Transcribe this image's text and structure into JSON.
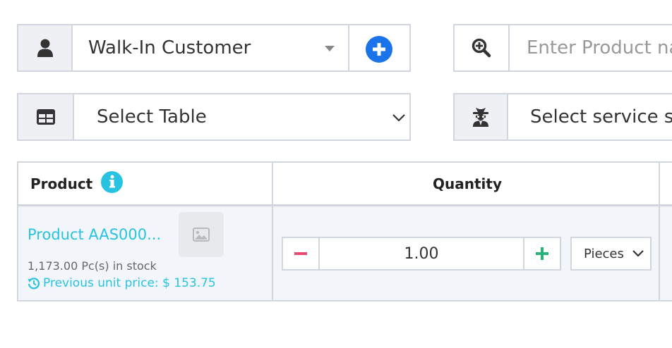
{
  "customer": {
    "icon": "user-icon",
    "value": "Walk-In Customer",
    "add_icon": "plus-circle-icon",
    "accent_color": "#1a73e8"
  },
  "product_search": {
    "icon": "search-plus-icon",
    "placeholder": "Enter Product na"
  },
  "table_select": {
    "icon": "table-icon",
    "value": "Select Table"
  },
  "service_staff": {
    "icon": "user-secret-icon",
    "value": "Select service sta"
  },
  "table": {
    "headers": {
      "product": "Product",
      "quantity": "Quantity"
    },
    "info_icon": "info-circle-icon",
    "rows": [
      {
        "product_name": "Product AAS000...",
        "stock": "1,173.00 Pc(s) in stock",
        "previous_price": "Previous unit price: $ 153.75",
        "quantity": "1.00",
        "unit": "Pieces"
      }
    ]
  },
  "colors": {
    "link": "#28c2e2",
    "minus": "#e64a6e",
    "plus": "#2ab27b",
    "border": "#d2d6de"
  }
}
